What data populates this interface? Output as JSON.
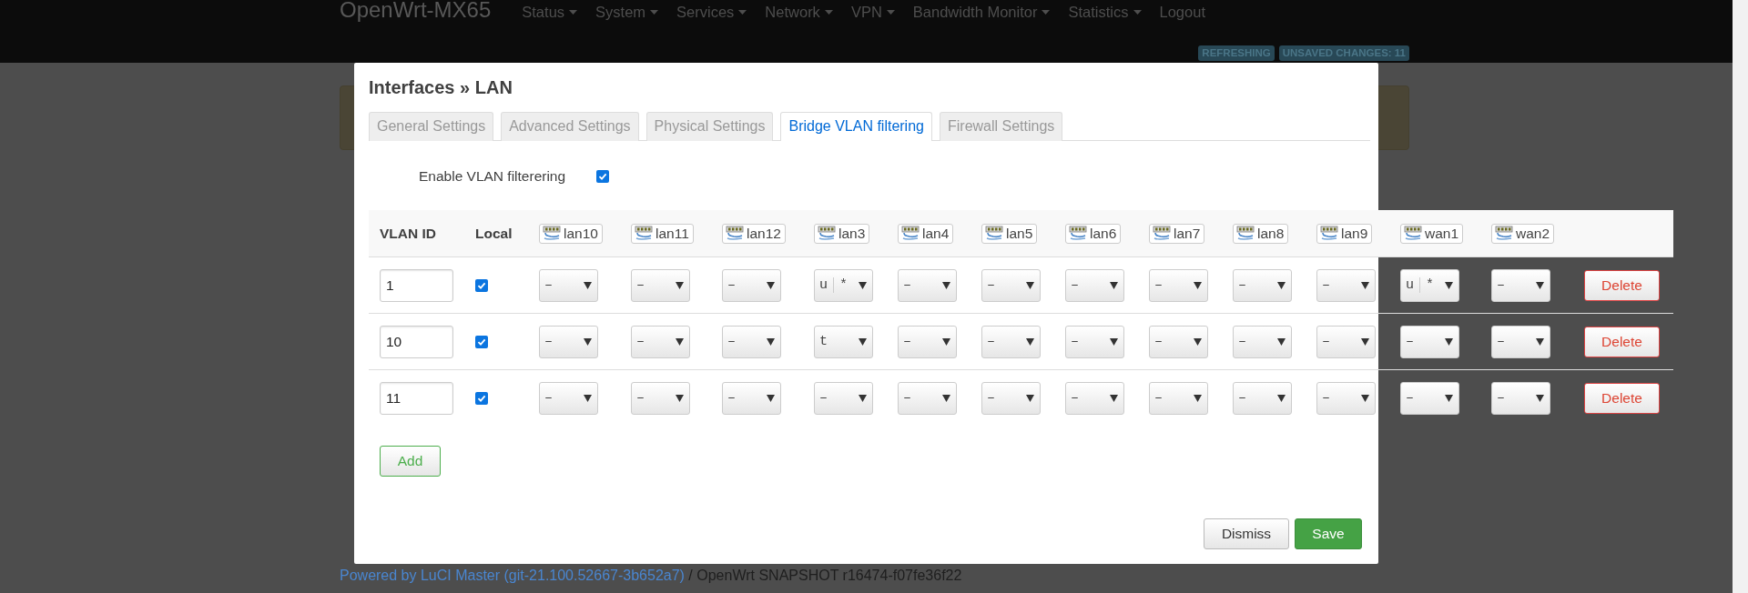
{
  "navbar": {
    "brand": "OpenWrt-MX65",
    "menu": [
      {
        "label": "Status",
        "dropdown": true
      },
      {
        "label": "System",
        "dropdown": true
      },
      {
        "label": "Services",
        "dropdown": true
      },
      {
        "label": "Network",
        "dropdown": true
      },
      {
        "label": "VPN",
        "dropdown": true
      },
      {
        "label": "Bandwidth Monitor",
        "dropdown": true
      },
      {
        "label": "Statistics",
        "dropdown": true
      },
      {
        "label": "Logout",
        "dropdown": false
      }
    ],
    "indicators": [
      "REFRESHING",
      "UNSAVED CHANGES: 11"
    ]
  },
  "modal": {
    "title": "Interfaces » LAN",
    "tabs": [
      {
        "label": "General Settings",
        "selected": false
      },
      {
        "label": "Advanced Settings",
        "selected": false
      },
      {
        "label": "Physical Settings",
        "selected": false
      },
      {
        "label": "Bridge VLAN filtering",
        "selected": true
      },
      {
        "label": "Firewall Settings",
        "selected": false
      }
    ],
    "enable_vlan_filtering": {
      "label": "Enable VLAN filterering",
      "checked": true
    },
    "table": {
      "vlan_id_header": "VLAN ID",
      "local_header": "Local",
      "ports": [
        "lan10",
        "lan11",
        "lan12",
        "lan3",
        "lan4",
        "lan5",
        "lan6",
        "lan7",
        "lan8",
        "lan9",
        "wan1",
        "wan2"
      ],
      "rows": [
        {
          "vlan_id": "1",
          "local": true,
          "ports": [
            [
              "–"
            ],
            [
              "–"
            ],
            [
              "–"
            ],
            [
              "u",
              "*"
            ],
            [
              "–"
            ],
            [
              "–"
            ],
            [
              "–"
            ],
            [
              "–"
            ],
            [
              "–"
            ],
            [
              "–"
            ],
            [
              "u",
              "*"
            ],
            [
              "–"
            ]
          ],
          "delete": "Delete"
        },
        {
          "vlan_id": "10",
          "local": true,
          "ports": [
            [
              "–"
            ],
            [
              "–"
            ],
            [
              "–"
            ],
            [
              "t"
            ],
            [
              "–"
            ],
            [
              "–"
            ],
            [
              "–"
            ],
            [
              "–"
            ],
            [
              "–"
            ],
            [
              "–"
            ],
            [
              "–"
            ],
            [
              "–"
            ]
          ],
          "delete": "Delete"
        },
        {
          "vlan_id": "11",
          "local": true,
          "ports": [
            [
              "–"
            ],
            [
              "–"
            ],
            [
              "–"
            ],
            [
              "–"
            ],
            [
              "–"
            ],
            [
              "–"
            ],
            [
              "–"
            ],
            [
              "–"
            ],
            [
              "–"
            ],
            [
              "–"
            ],
            [
              "–"
            ],
            [
              "–"
            ]
          ],
          "delete": "Delete"
        }
      ]
    },
    "add_button": "Add",
    "buttons": [
      {
        "label": "Dismiss",
        "kind": "default"
      },
      {
        "label": "Save",
        "kind": "primary"
      }
    ]
  },
  "footer": {
    "link": "Powered by LuCI Master (git-21.100.52667-3b652a7)",
    "text": "/ OpenWrt SNAPSHOT r16474-f07fe36f22"
  }
}
